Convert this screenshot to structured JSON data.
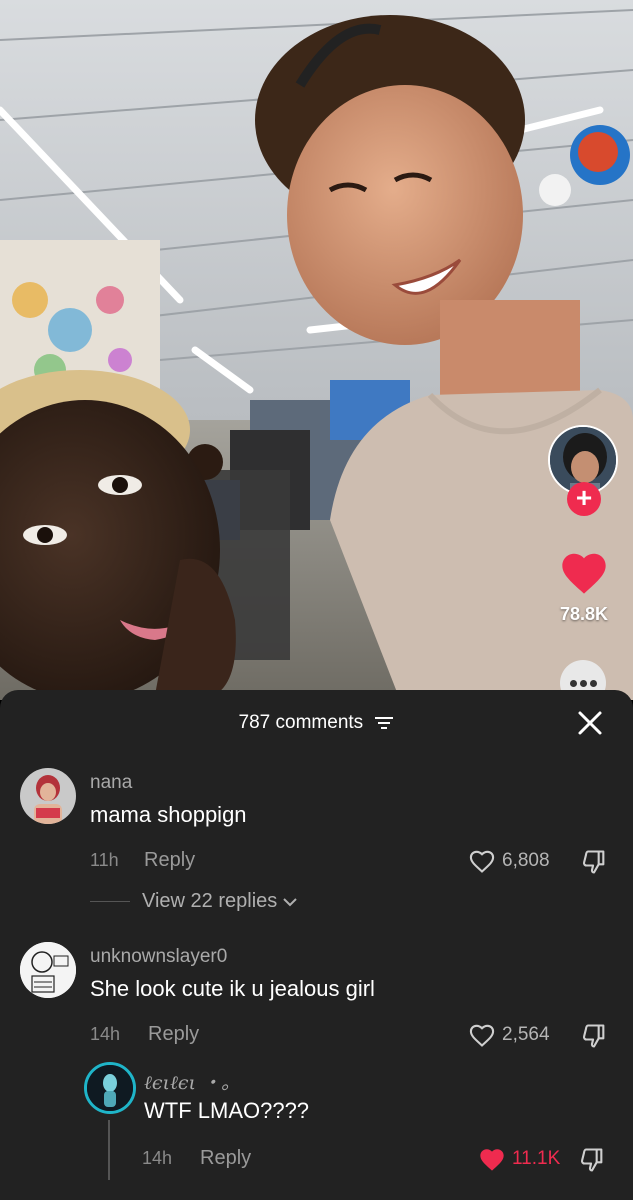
{
  "rail": {
    "follow_symbol": "+",
    "like_count": "78.8K",
    "like_color": "#ef2b4f"
  },
  "comments_panel": {
    "title": "787 comments",
    "close_symbol": "✕",
    "comments": [
      {
        "username": "nana",
        "text": "mama shoppign",
        "time": "11h",
        "reply_label": "Reply",
        "likes": "6,808",
        "view_replies": "View 22 replies"
      },
      {
        "username": "unknownslayer0",
        "text": "She look cute ik u jealous girl",
        "time": "14h",
        "reply_label": "Reply",
        "likes": "2,564"
      }
    ],
    "reply": {
      "username": "ℓєιℓєι ・。",
      "text": "WTF LMAO????",
      "time": "14h",
      "reply_label": "Reply",
      "likes": "11.1K",
      "liked": true,
      "like_color": "#ef2b4f"
    }
  }
}
